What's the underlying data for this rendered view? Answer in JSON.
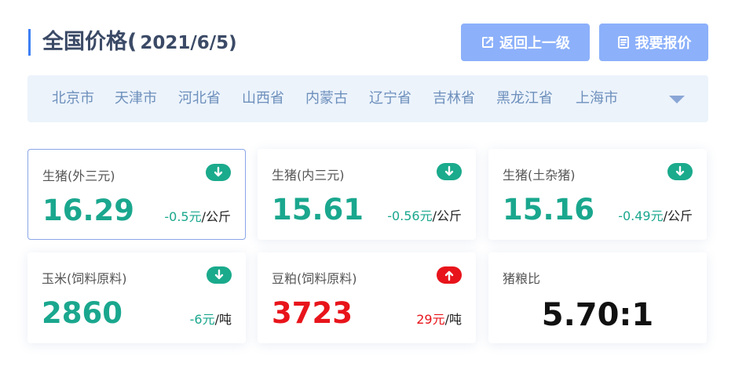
{
  "header": {
    "title": "全国价格(",
    "date": "2021/6/5)",
    "back_button": "返回上一级",
    "quote_button": "我要报价"
  },
  "regions": [
    "北京市",
    "天津市",
    "河北省",
    "山西省",
    "内蒙古",
    "辽宁省",
    "吉林省",
    "黑龙江省",
    "上海市"
  ],
  "cards": [
    {
      "name": "生猪(外三元)",
      "price": "16.29",
      "delta": "-0.5元",
      "unit": "/公斤",
      "trend": "down"
    },
    {
      "name": "生猪(内三元)",
      "price": "15.61",
      "delta": "-0.56元",
      "unit": "/公斤",
      "trend": "down"
    },
    {
      "name": "生猪(土杂猪)",
      "price": "15.16",
      "delta": "-0.49元",
      "unit": "/公斤",
      "trend": "down"
    },
    {
      "name": "玉米(饲料原料)",
      "price": "2860",
      "delta": "-6元",
      "unit": "/吨",
      "trend": "down"
    },
    {
      "name": "豆粕(饲料原料)",
      "price": "3723",
      "delta": "29元",
      "unit": "/吨",
      "trend": "up"
    },
    {
      "name": "猪粮比",
      "ratio": "5.70:1"
    }
  ],
  "colors": {
    "accent": "#3d7ff5",
    "button": "#8cb0fa",
    "down": "#1aa78e",
    "up": "#e8141b"
  },
  "icons": {
    "back": "share-out-icon",
    "quote": "document-icon",
    "down": "arrow-down-circle-icon",
    "up": "arrow-up-circle-icon",
    "toggle": "caret-down-icon"
  }
}
